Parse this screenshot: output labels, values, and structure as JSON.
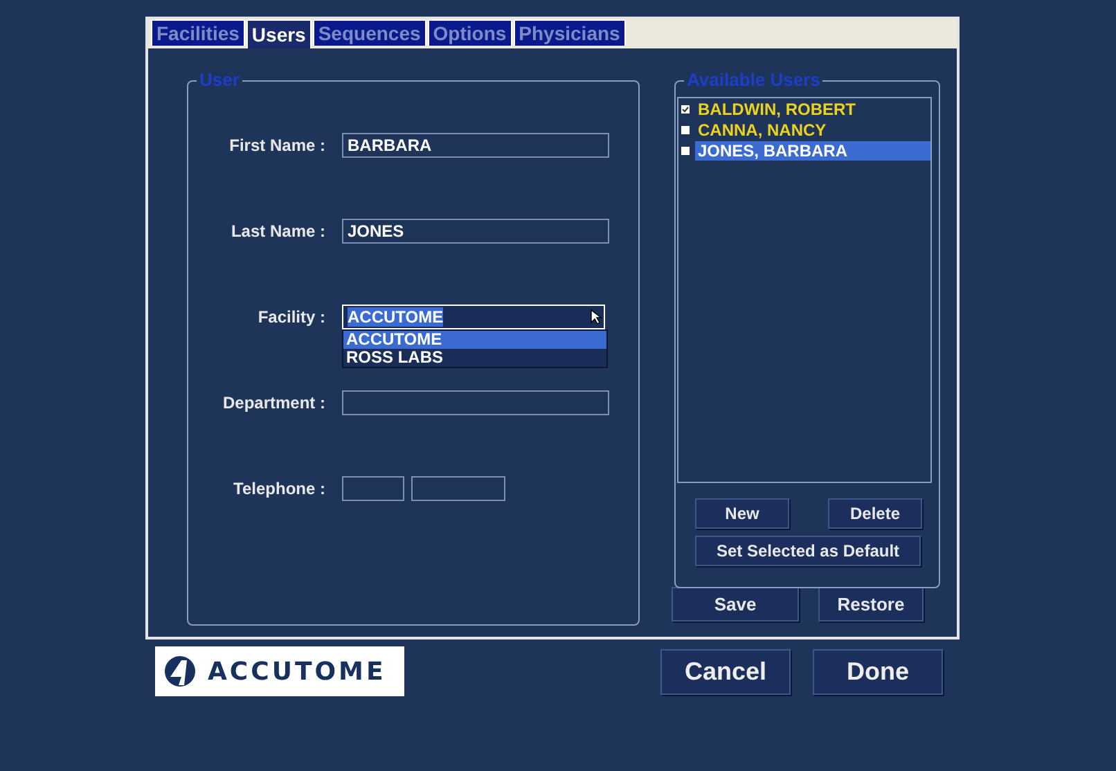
{
  "tabs": [
    {
      "label": "Facilities",
      "selected": false
    },
    {
      "label": "Users",
      "selected": true
    },
    {
      "label": "Sequences",
      "selected": false
    },
    {
      "label": "Options",
      "selected": false
    },
    {
      "label": "Physicians",
      "selected": false
    }
  ],
  "user_group": {
    "title": "User",
    "fields": [
      {
        "kind": "text",
        "label": "First Name :",
        "value": "BARBARA"
      },
      {
        "kind": "text",
        "label": "Last Name :",
        "value": "JONES"
      },
      {
        "kind": "select",
        "label": "Facility :",
        "value": "ACCUTOME",
        "expanded": true,
        "options": [
          {
            "label": "ACCUTOME",
            "selected": true
          },
          {
            "label": "ROSS LABS",
            "selected": false
          }
        ]
      },
      {
        "kind": "text",
        "label": "Department :"
      },
      {
        "kind": "phone",
        "label": "Telephone :"
      }
    ]
  },
  "available_users": {
    "title": "Available Users",
    "items": [
      {
        "name": "BALDWIN, ROBERT",
        "checked": true,
        "selected": false
      },
      {
        "name": "CANNA, NANCY",
        "checked": false,
        "selected": false
      },
      {
        "name": "JONES, BARBARA",
        "checked": false,
        "selected": true
      }
    ]
  },
  "list_buttons": [
    "New",
    "Delete"
  ],
  "default_button": "Set Selected as Default",
  "panel_buttons": [
    "Save",
    "Restore"
  ],
  "logo": "ACCUTOME",
  "footer_buttons": [
    "Cancel",
    "Done"
  ]
}
